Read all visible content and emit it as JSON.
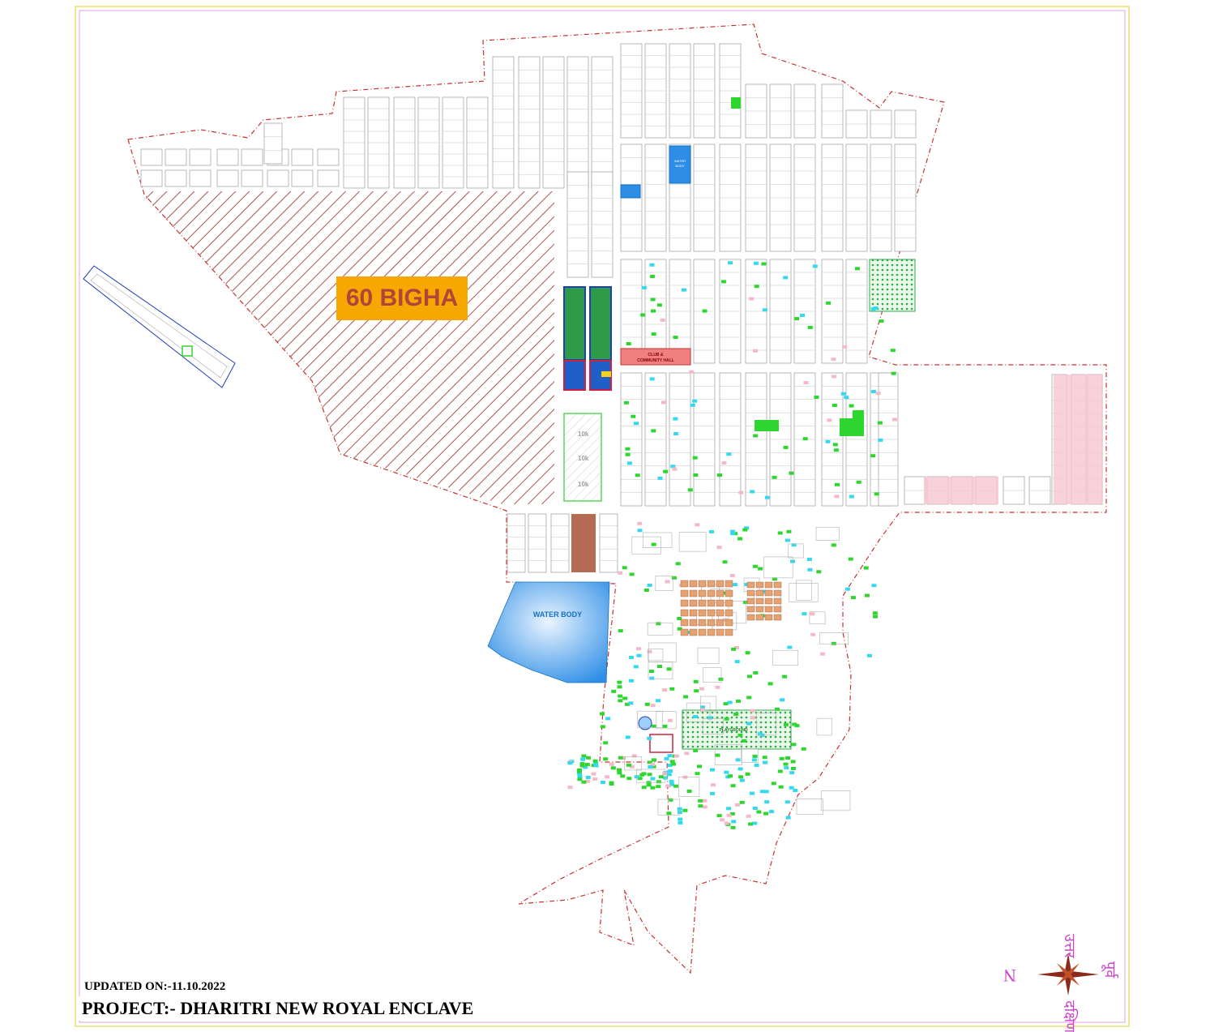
{
  "map": {
    "land_label": "60 BIGHA",
    "water_body_large": "WATER BODY",
    "water_body_small_line1": "WATER",
    "water_body_small_line2": "BODY",
    "club_line1": "CLUB &",
    "club_line2": "COMMUNITY HALL",
    "tank_label": "10k",
    "playground_label": "PLAYGROUND"
  },
  "footer": {
    "updated": "UPDATED ON:-11.10.2022",
    "project": "PROJECT:- DHARITRI NEW ROYAL ENCLAVE"
  },
  "compass": {
    "north": "N",
    "north_hi": "उत्तर",
    "south_hi": "दक्षिण",
    "east_hi": "पूर्व"
  },
  "colors": {
    "boundary": "#c8322e",
    "hatch": "#a9554f",
    "label_bg": "#f7a800",
    "label_text": "#b3443c",
    "water": "#2e8ee6",
    "green": "#2fd62f",
    "cyan": "#35d9ef",
    "pink": "#f5b8c8",
    "frame": "#e8e070"
  }
}
